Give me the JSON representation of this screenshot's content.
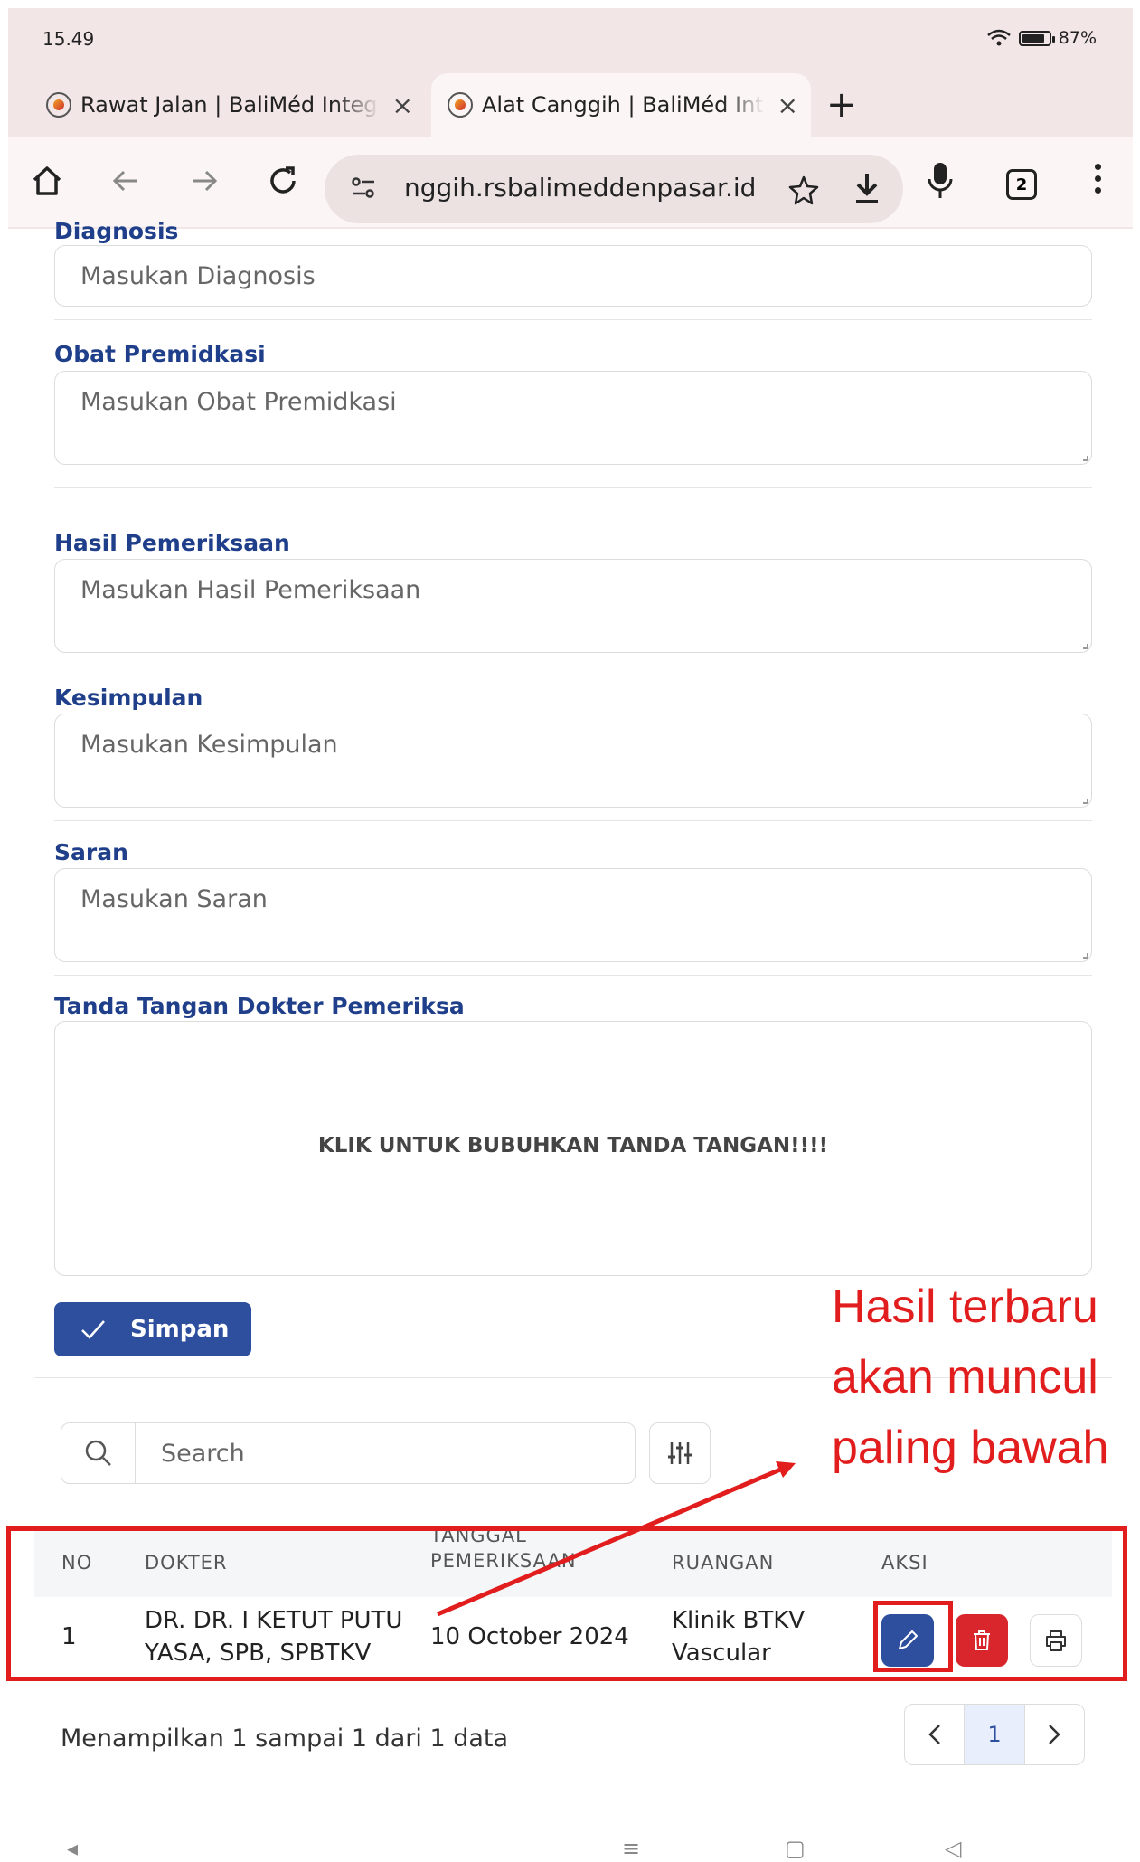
{
  "status": {
    "time": "15.49",
    "battery": "87%"
  },
  "tabs": [
    {
      "label": "Rawat Jalan | BaliMéd Integra",
      "close": "×"
    },
    {
      "label": "Alat Canggih | BaliMéd Integra",
      "close": "×"
    }
  ],
  "new_tab": "+",
  "omnibox": {
    "url": "nggih.rsbalimeddenpasar.id",
    "tab_count": "2"
  },
  "form": {
    "diagnosis_label": "Diagnosis",
    "diagnosis_placeholder": "Masukan Diagnosis",
    "obat_label": "Obat Premidkasi",
    "obat_placeholder": "Masukan Obat Premidkasi",
    "hasil_label": "Hasil Pemeriksaan",
    "hasil_placeholder": "Masukan Hasil Pemeriksaan",
    "kesimpulan_label": "Kesimpulan",
    "kesimpulan_placeholder": "Masukan Kesimpulan",
    "saran_label": "Saran",
    "saran_placeholder": "Masukan Saran",
    "ttd_label": "Tanda Tangan Dokter Pemeriksa",
    "ttd_prompt": "KLIK UNTUK BUBUHKAN TANDA TANGAN!!!!",
    "save_label": "Simpan"
  },
  "search": {
    "placeholder": "Search"
  },
  "table": {
    "headers": {
      "no": "NO",
      "dokter": "DOKTER",
      "tanggal_1": "TANGGAL",
      "tanggal_2": "PEMERIKSAAN",
      "ruangan": "RUANGAN",
      "aksi": "AKSI"
    },
    "rows": [
      {
        "no": "1",
        "dokter_1": "DR. DR. I KETUT PUTU",
        "dokter_2": "YASA, SPB, SPBTKV",
        "tanggal": "10 October 2024",
        "ruangan_1": "Klinik BTKV",
        "ruangan_2": "Vascular"
      }
    ]
  },
  "footer": {
    "info": "Menampilkan 1 sampai 1 dari 1 data",
    "page": "1"
  },
  "annotation": {
    "line1": "Hasil terbaru",
    "line2": "akan muncul",
    "line3": "paling bawah",
    "color": "#e11d1d"
  },
  "colors": {
    "primary": "#2d4f9e",
    "danger": "#d9262c",
    "label": "#1f3f8a"
  }
}
